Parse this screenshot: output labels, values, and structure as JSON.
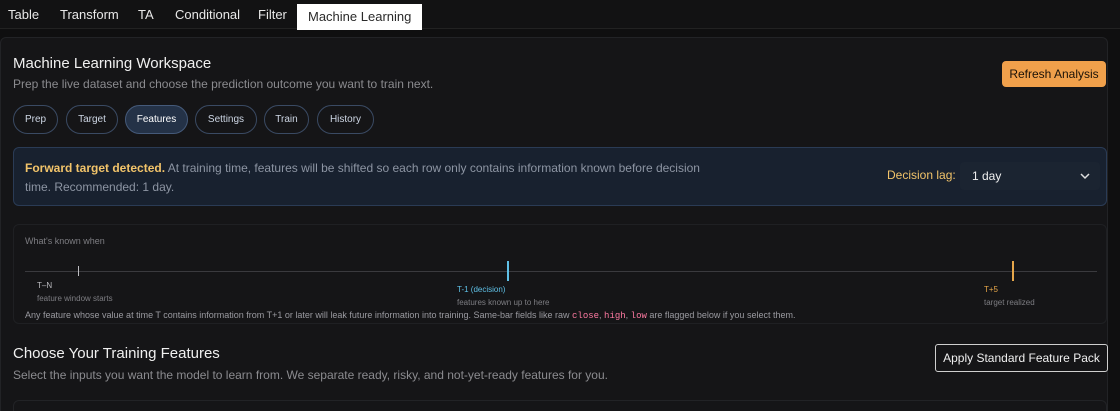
{
  "tabs": [
    "Table",
    "Transform",
    "TA",
    "Conditional",
    "Filter",
    "Machine Learning"
  ],
  "active_tab": "Machine Learning",
  "workspace": {
    "title": "Machine Learning Workspace",
    "subtitle": "Prep the live dataset and choose the prediction outcome you want to train next.",
    "refresh_label": "Refresh Analysis"
  },
  "steps": [
    "Prep",
    "Target",
    "Features",
    "Settings",
    "Train",
    "History"
  ],
  "active_step": "Features",
  "alert": {
    "strong": "Forward target detected.",
    "text": " At training time, features will be shifted so each row only contains information known before decision time. Recommended: 1 day.",
    "lag_label": "Decision lag:",
    "lag_value": "1 day"
  },
  "timeline": {
    "caption": "What's known when",
    "points": [
      {
        "label": "T–N",
        "sub": "feature window starts",
        "color": "#bdbdc2"
      },
      {
        "label": "T-1 (decision)",
        "sub": "features known up to here",
        "color": "#5fc0e6"
      },
      {
        "label": "T+5",
        "sub": "target realized",
        "color": "#e6a64a"
      }
    ],
    "note_before": "Any feature whose value at time T contains information from T+1 or later will leak future information into training. Same-bar fields like raw ",
    "note_codes": [
      "close",
      "high",
      "low"
    ],
    "note_after": " are flagged below if you select them."
  },
  "features": {
    "title": "Choose Your Training Features",
    "subtitle": "Select the inputs you want the model to learn from. We separate ready, risky, and not-yet-ready features for you.",
    "pack_label": "Apply Standard Feature Pack"
  },
  "colors": {
    "accent": "#f0a04b",
    "warning": "#f2c46a",
    "decision": "#5fc0e6",
    "target": "#e6a64a"
  }
}
